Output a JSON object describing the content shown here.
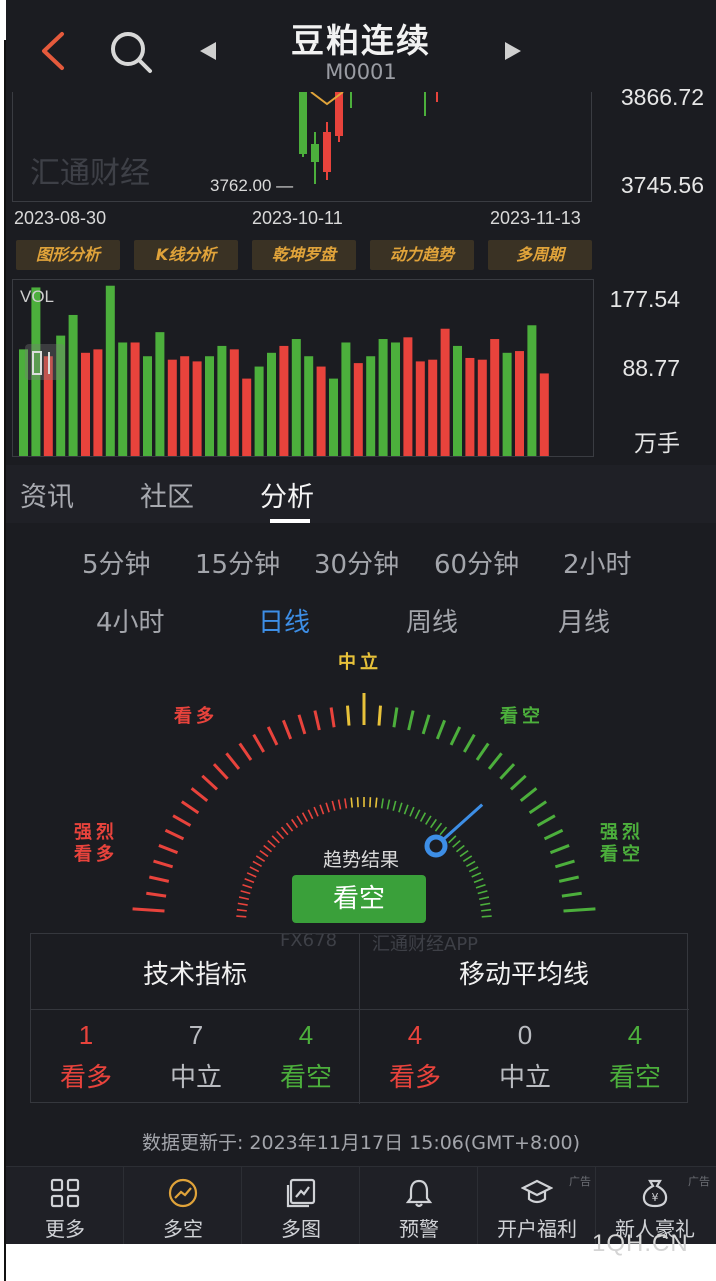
{
  "header": {
    "title": "豆粕连续",
    "code": "M0001"
  },
  "price_chart": {
    "price_top": "3866.72",
    "price_bottom": "3745.56",
    "min_label": "3762.00 —",
    "watermark": "汇通财经",
    "dates": [
      "2023-08-30",
      "2023-10-11",
      "2023-11-13"
    ]
  },
  "tools": [
    "图形分析",
    "K线分析",
    "乾坤罗盘",
    "动力趋势",
    "多周期"
  ],
  "volume": {
    "label": "VOL",
    "max": "177.54",
    "mid": "88.77",
    "unit": "万手",
    "bars": [
      {
        "v": 0.62,
        "c": "g"
      },
      {
        "v": 0.98,
        "c": "g"
      },
      {
        "v": 0.58,
        "c": "r"
      },
      {
        "v": 0.7,
        "c": "g"
      },
      {
        "v": 0.82,
        "c": "g"
      },
      {
        "v": 0.6,
        "c": "r"
      },
      {
        "v": 0.62,
        "c": "r"
      },
      {
        "v": 0.99,
        "c": "g"
      },
      {
        "v": 0.66,
        "c": "g"
      },
      {
        "v": 0.66,
        "c": "r"
      },
      {
        "v": 0.58,
        "c": "g"
      },
      {
        "v": 0.72,
        "c": "g"
      },
      {
        "v": 0.56,
        "c": "r"
      },
      {
        "v": 0.58,
        "c": "r"
      },
      {
        "v": 0.55,
        "c": "r"
      },
      {
        "v": 0.58,
        "c": "g"
      },
      {
        "v": 0.64,
        "c": "g"
      },
      {
        "v": 0.62,
        "c": "r"
      },
      {
        "v": 0.45,
        "c": "r"
      },
      {
        "v": 0.52,
        "c": "g"
      },
      {
        "v": 0.6,
        "c": "g"
      },
      {
        "v": 0.64,
        "c": "r"
      },
      {
        "v": 0.68,
        "c": "g"
      },
      {
        "v": 0.58,
        "c": "g"
      },
      {
        "v": 0.52,
        "c": "r"
      },
      {
        "v": 0.45,
        "c": "g"
      },
      {
        "v": 0.66,
        "c": "g"
      },
      {
        "v": 0.54,
        "c": "r"
      },
      {
        "v": 0.58,
        "c": "g"
      },
      {
        "v": 0.68,
        "c": "g"
      },
      {
        "v": 0.66,
        "c": "g"
      },
      {
        "v": 0.69,
        "c": "r"
      },
      {
        "v": 0.55,
        "c": "r"
      },
      {
        "v": 0.56,
        "c": "r"
      },
      {
        "v": 0.74,
        "c": "r"
      },
      {
        "v": 0.64,
        "c": "g"
      },
      {
        "v": 0.57,
        "c": "r"
      },
      {
        "v": 0.56,
        "c": "r"
      },
      {
        "v": 0.68,
        "c": "r"
      },
      {
        "v": 0.6,
        "c": "g"
      },
      {
        "v": 0.61,
        "c": "r"
      },
      {
        "v": 0.76,
        "c": "g"
      },
      {
        "v": 0.48,
        "c": "r"
      }
    ]
  },
  "tabs": {
    "info": "资讯",
    "community": "社区",
    "analysis": "分析"
  },
  "periods": {
    "row1": [
      "5分钟",
      "15分钟",
      "30分钟",
      "60分钟",
      "2小时"
    ],
    "row2": [
      "4小时",
      "日线",
      "周线",
      "月线"
    ],
    "active": "日线"
  },
  "gauge": {
    "neutral": "中立",
    "buy": "看多",
    "sell": "看空",
    "strong_buy_1": "强烈",
    "strong_buy_2": "看多",
    "strong_sell_1": "强烈",
    "strong_sell_2": "看空",
    "trend_label": "趋势结果",
    "result": "看空",
    "needle_level": 0.78,
    "colors": {
      "red": "#e8433c",
      "yellow": "#e8c23a",
      "green": "#4caf3c"
    }
  },
  "summary": {
    "watermark_left": "FX678",
    "watermark_right": "汇通财经APP",
    "technical": {
      "title": "技术指标",
      "buy": {
        "count": "1",
        "label": "看多"
      },
      "neutral": {
        "count": "7",
        "label": "中立"
      },
      "sell": {
        "count": "4",
        "label": "看空"
      }
    },
    "moving_average": {
      "title": "移动平均线",
      "buy": {
        "count": "4",
        "label": "看多"
      },
      "neutral": {
        "count": "0",
        "label": "中立"
      },
      "sell": {
        "count": "4",
        "label": "看空"
      }
    }
  },
  "update_text": "数据更新于: 2023年11月17日 15:06(GMT+8:00)",
  "nav": [
    {
      "label": "更多",
      "icon": "grid-icon"
    },
    {
      "label": "多空",
      "icon": "trend-circle-icon"
    },
    {
      "label": "多图",
      "icon": "multi-chart-icon"
    },
    {
      "label": "预警",
      "icon": "bell-icon"
    },
    {
      "label": "开户福利",
      "icon": "graduation-cap-icon",
      "ad": "广告"
    },
    {
      "label": "新人豪礼",
      "icon": "money-bag-icon",
      "ad": "广告"
    }
  ],
  "site_mark": "1QH.CN"
}
